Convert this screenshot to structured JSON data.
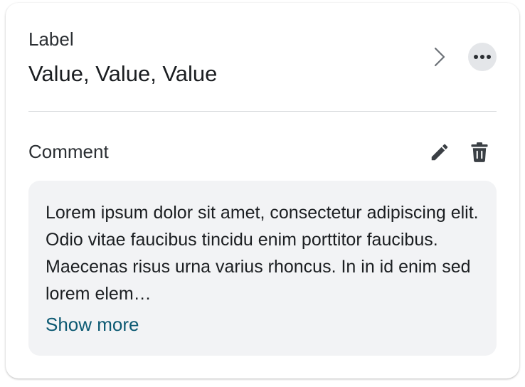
{
  "field": {
    "label": "Label",
    "value": "Value, Value, Value",
    "chevron_icon": "chevron-right-icon",
    "more_icon": "more-horizontal-icon"
  },
  "comment": {
    "label": "Comment",
    "edit_icon": "pencil-icon",
    "delete_icon": "trash-icon",
    "text": "Lorem ipsum dolor sit amet, consectetur adipiscing elit. Odio vitae faucibus tincidu enim porttitor faucibus. Maecenas risus urna varius rhoncus. In in id enim sed lorem elem…",
    "show_more_label": "Show more"
  },
  "colors": {
    "link": "#0d5a73",
    "comment_bg": "#f2f3f5",
    "more_button_bg": "#e4e6e9",
    "divider": "#d6d9dc"
  }
}
